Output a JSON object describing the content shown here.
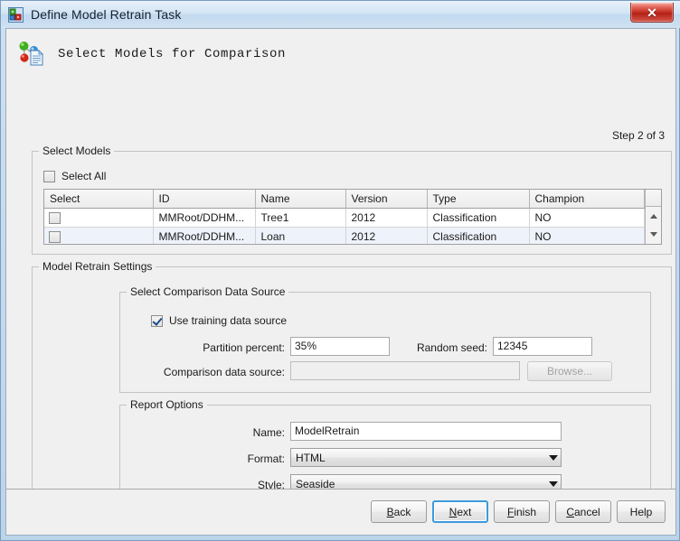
{
  "window": {
    "title": "Define Model Retrain Task",
    "title_icon": "app-icon",
    "close_label": "✕"
  },
  "header": {
    "title": "Select Models for Comparison",
    "icon": "model-comparison-icon"
  },
  "step": {
    "label": "Step 2 of 3"
  },
  "select_models": {
    "legend": "Select Models",
    "select_all_label": "Select All",
    "select_all_checked": false,
    "columns": [
      "Select",
      "ID",
      "Name",
      "Version",
      "Type",
      "Champion"
    ],
    "rows": [
      {
        "selected": false,
        "id": "MMRoot/DDHM...",
        "name": "Tree1",
        "version": "2012",
        "type": "Classification",
        "champion": "NO"
      },
      {
        "selected": false,
        "id": "MMRoot/DDHM...",
        "name": "Loan",
        "version": "2012",
        "type": "Classification",
        "champion": "NO"
      }
    ]
  },
  "retrain_settings": {
    "legend": "Model Retrain Settings",
    "data_source": {
      "legend": "Select Comparison Data Source",
      "use_training_label": "Use training data source",
      "use_training_checked": true,
      "partition_percent_label": "Partition percent:",
      "partition_percent_value": "35%",
      "random_seed_label": "Random seed:",
      "random_seed_value": "12345",
      "comparison_label": "Comparison data source:",
      "comparison_value": "",
      "browse_label": "Browse..."
    },
    "report_options": {
      "legend": "Report Options",
      "name_label": "Name:",
      "name_value": "ModelRetrain",
      "format_label": "Format:",
      "format_value": "HTML",
      "style_label": "Style:",
      "style_value": "Seaside"
    }
  },
  "footer": {
    "buttons": [
      {
        "pre": "",
        "mnemonic": "B",
        "post": "ack",
        "focused": false
      },
      {
        "pre": "",
        "mnemonic": "N",
        "post": "ext",
        "focused": true
      },
      {
        "pre": "",
        "mnemonic": "F",
        "post": "inish",
        "focused": false
      },
      {
        "pre": "",
        "mnemonic": "C",
        "post": "ancel",
        "focused": false
      },
      {
        "pre": "Help",
        "mnemonic": "",
        "post": "",
        "focused": false
      }
    ]
  }
}
